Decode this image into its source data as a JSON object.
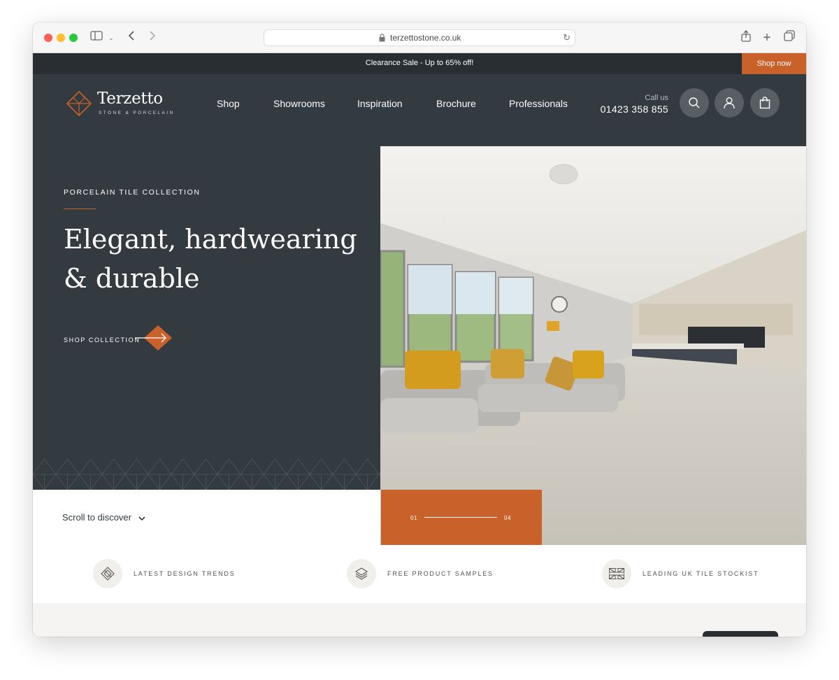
{
  "browser": {
    "url": "terzettostone.co.uk"
  },
  "promo": {
    "text": "Clearance Sale - Up to 65% off!",
    "button": "Shop now"
  },
  "brand": {
    "name": "Terzetto",
    "tagline": "STONE & PORCELAIN",
    "accent": "#c9622a",
    "dark": "#333a40"
  },
  "nav": {
    "items": [
      "Shop",
      "Showrooms",
      "Inspiration",
      "Brochure",
      "Professionals"
    ]
  },
  "contact": {
    "label": "Call us",
    "phone": "01423 358 855"
  },
  "header_icons": [
    "search-icon",
    "account-icon",
    "cart-icon"
  ],
  "hero": {
    "eyebrow": "PORCELAIN TILE COLLECTION",
    "title": "Elegant, hardwearing & durable",
    "cta": "SHOP COLLECTION",
    "slide_current": "01",
    "slide_total": "04"
  },
  "scroll_hint": "Scroll to discover",
  "usps": [
    {
      "icon": "diamond-tile-icon",
      "label": "LATEST DESIGN TRENDS"
    },
    {
      "icon": "layers-icon",
      "label": "FREE PRODUCT SAMPLES"
    },
    {
      "icon": "union-jack-icon",
      "label": "LEADING UK TILE STOCKIST"
    }
  ]
}
